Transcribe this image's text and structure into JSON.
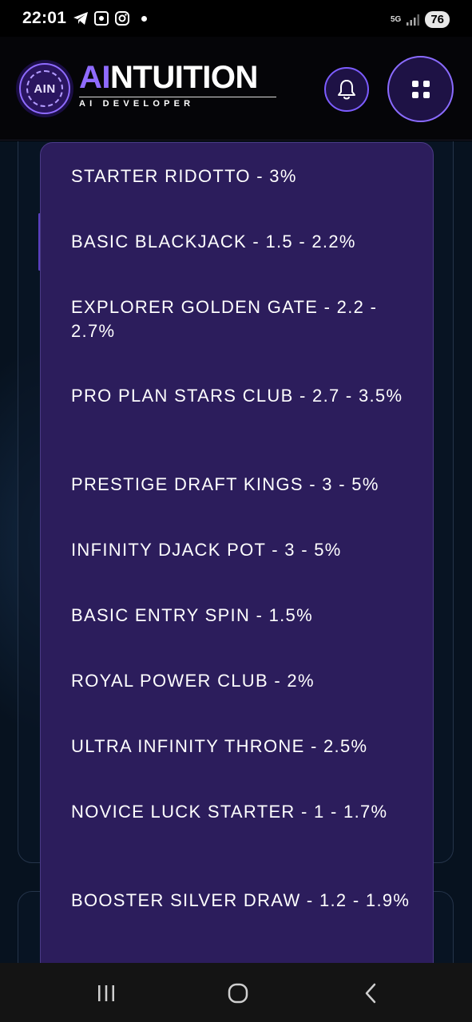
{
  "status_bar": {
    "time": "22:01",
    "network": "5G",
    "battery": "76",
    "icons": [
      "telegram-icon",
      "screen-record-icon",
      "instagram-icon",
      "notification-dot",
      "signal-icon"
    ]
  },
  "header": {
    "logo_badge_text": "AIN",
    "logo_accent": "AI",
    "logo_rest": "NTUITION",
    "logo_subtitle": "AI DEVELOPER",
    "accent_color": "#8f6bff",
    "bell_icon": "bell-icon",
    "menu_icon": "grid-menu-icon"
  },
  "dropdown": {
    "background": "#2c1d5c",
    "options": [
      "STARTER RIDOTTO - 3%",
      "BASIC BLACKJACK - 1.5 - 2.2%",
      "EXPLORER GOLDEN GATE - 2.2 - 2.7%",
      "PRO PLAN STARS CLUB - 2.7 - 3.5%",
      "PRESTIGE DRAFT KINGS - 3 - 5%",
      "INFINITY DJACK POT - 3 - 5%",
      "BASIC ENTRY SPIN - 1.5%",
      "ROYAL POWER CLUB - 2%",
      "ULTRA INFINITY THRONE - 2.5%",
      "NOVICE LUCK STARTER - 1 - 1.7%",
      "BOOSTER SILVER DRAW - 1.2 - 1.9%"
    ]
  },
  "nav_bar": {
    "icons": [
      "recent-apps-icon",
      "home-icon",
      "back-icon"
    ]
  }
}
